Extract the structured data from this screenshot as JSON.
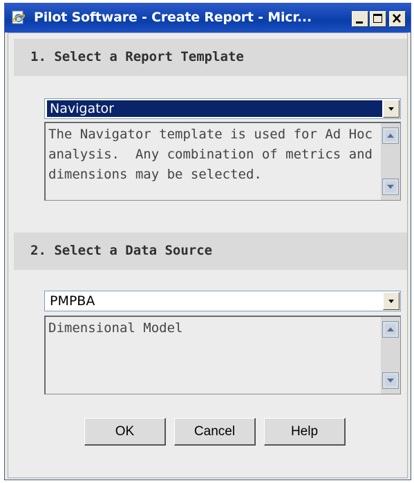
{
  "window": {
    "title": "Pilot Software - Create Report - Micr..."
  },
  "section1": {
    "heading": "1. Select a Report Template",
    "template_selected": "Navigator",
    "description": "The Navigator template is used for Ad Hoc analysis.  Any combination of metrics and dimensions may be selected."
  },
  "section2": {
    "heading": "2. Select a Data Source",
    "source_selected": "PMPBA",
    "description": "Dimensional Model"
  },
  "buttons": {
    "ok": "OK",
    "cancel": "Cancel",
    "help": "Help"
  },
  "icons": {
    "app": "ie-page-icon",
    "minimize": "minimize-icon",
    "maximize": "maximize-icon",
    "close": "close-icon",
    "dropdown": "chevron-down-icon",
    "scroll_up": "scroll-up-icon",
    "scroll_down": "scroll-down-icon"
  },
  "colors": {
    "titlebar": "#0a3ea8",
    "selection": "#0a246a",
    "section_band": "#dadada"
  }
}
